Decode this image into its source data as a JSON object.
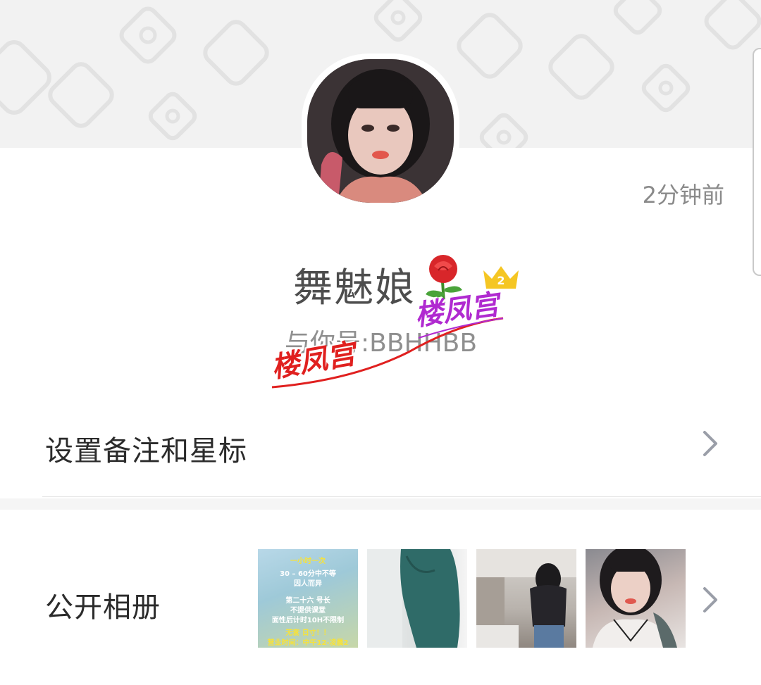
{
  "profile": {
    "time_ago": "2分钟前",
    "nickname": "舞魅娘",
    "wechat_id": "与你号:BBHHBB"
  },
  "watermark": {
    "text_1": "楼凤宫",
    "text_2": "楼凤宫"
  },
  "crown": {
    "level": "2"
  },
  "rows": {
    "remark_label": "设置备注和星标",
    "album_label": "公开相册"
  },
  "album": {
    "poster_lines": [
      "一小时一次",
      "30 – 60分中不等",
      "因人而异",
      "第二十六 号长",
      "不提供课堂",
      "面性后计时10H不限制",
      "无套 日寸！！",
      "营业时间：中午12-凌晨2"
    ]
  },
  "colors": {
    "cover_bg": "#f2f2f2",
    "text_primary": "#2b2b2b",
    "text_secondary": "#8a8a8a",
    "watermark_red": "#e0201f",
    "watermark_purple": "#b02ad0",
    "crown_gold": "#f5c623"
  }
}
